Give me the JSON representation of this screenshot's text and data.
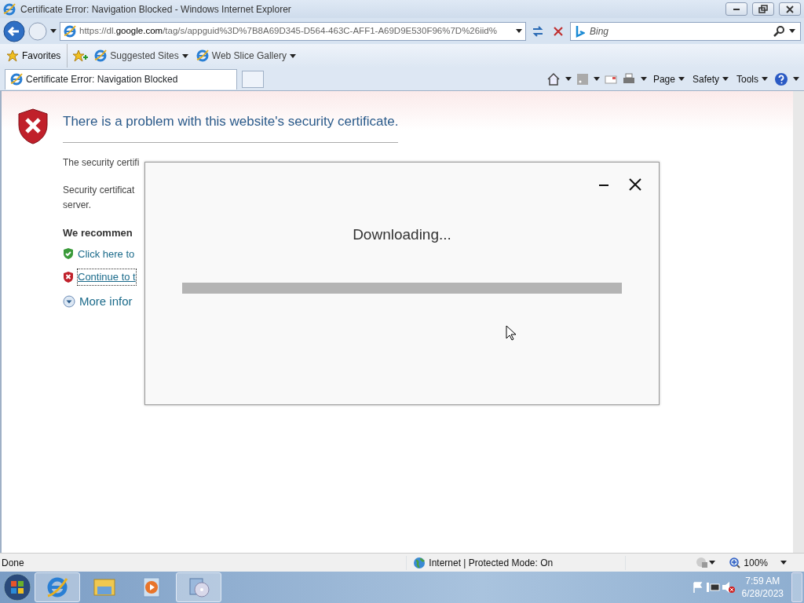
{
  "window": {
    "title": "Certificate Error: Navigation Blocked - Windows Internet Explorer"
  },
  "address_bar": {
    "url": "https://dl.**google.com**/tag/s/appguid%3D%7B8A69D345-D564-463C-AFF1-A69D9E530F96%7D%26iid%"
  },
  "search": {
    "placeholder": "Bing"
  },
  "favorites_bar": {
    "favorites": "Favorites",
    "items": [
      "Suggested Sites",
      "Web Slice Gallery"
    ]
  },
  "tabs": [
    {
      "label": "Certificate Error: Navigation Blocked",
      "selected": true
    }
  ],
  "command_bar": [
    "Page",
    "Safety",
    "Tools"
  ],
  "page": {
    "heading": "There is a problem with this website's security certificate.",
    "paragraphs": [
      [
        "The security certifi"
      ],
      [
        "Security certificat",
        "server."
      ]
    ],
    "recommendation": "We recommen",
    "links": [
      {
        "text": "Click here to",
        "kind": "safe"
      },
      {
        "text": "Continue to t",
        "kind": "unsafe"
      }
    ],
    "more_info": "More infor"
  },
  "dialog": {
    "title": "Downloading...",
    "level": 0
  },
  "status_bar": {
    "text": "Done",
    "zone": "Internet | Protected Mode: On",
    "zoom": "100%"
  },
  "taskbar": {
    "time": "7:59 AM",
    "date": "6/28/2023",
    "apps": [
      {
        "kind": "browser",
        "selected": true
      },
      {
        "kind": "folder",
        "selected": false
      },
      {
        "kind": "media",
        "selected": false
      },
      {
        "kind": "installer",
        "selected": true
      }
    ]
  }
}
